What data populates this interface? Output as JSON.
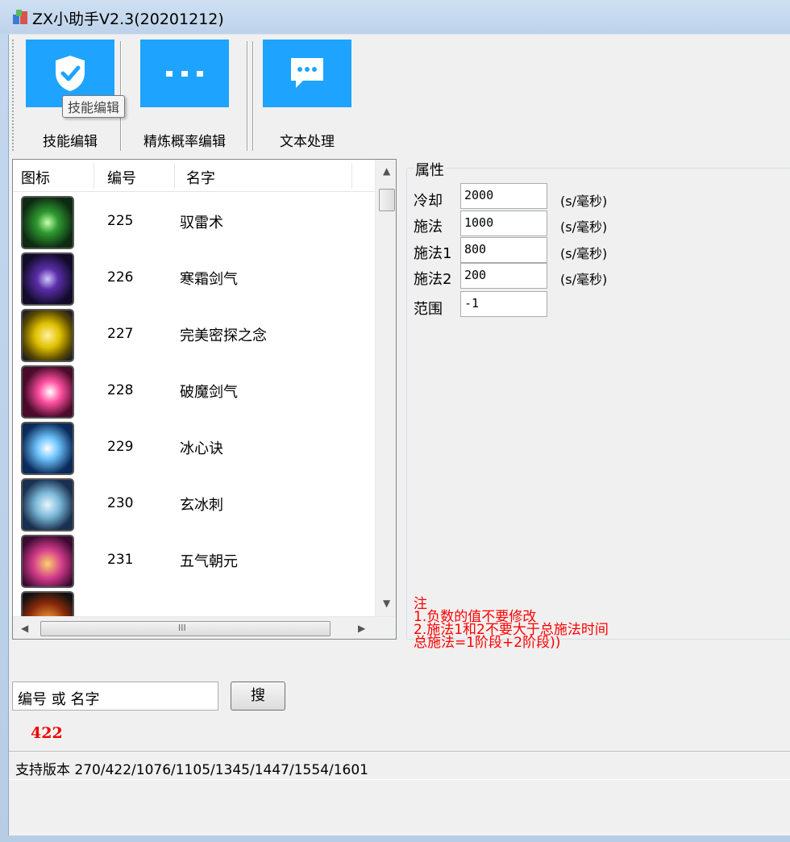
{
  "window": {
    "title": "ZX小助手V2.3(20201212)"
  },
  "toolbar": {
    "buttons": [
      {
        "label": "技能编辑",
        "icon": "shield-check-icon"
      },
      {
        "label": "精炼概率编辑",
        "icon": "dots-icon"
      },
      {
        "label": "文本处理",
        "icon": "chat-bubble-icon"
      }
    ],
    "tooltip": "技能编辑",
    "accent": "#1ea4ff"
  },
  "list": {
    "columns": [
      "图标",
      "编号",
      "名字"
    ],
    "rows": [
      {
        "id": "225",
        "name": "驭雷术",
        "icon": "lightning-skill-icon"
      },
      {
        "id": "226",
        "name": "寒霜剑气",
        "icon": "frost-sword-icon"
      },
      {
        "id": "227",
        "name": "完美密探之念",
        "icon": "golden-orb-icon"
      },
      {
        "id": "228",
        "name": "破魔剑气",
        "icon": "demon-break-icon"
      },
      {
        "id": "229",
        "name": "冰心诀",
        "icon": "ice-heart-icon"
      },
      {
        "id": "230",
        "name": "玄冰刺",
        "icon": "ice-spike-icon"
      },
      {
        "id": "231",
        "name": "五气朝元",
        "icon": "five-qi-icon"
      }
    ]
  },
  "properties": {
    "title": "属性",
    "fields": [
      {
        "label": "冷却",
        "value": "2000",
        "unit": "(s/毫秒)"
      },
      {
        "label": "施法",
        "value": "1000",
        "unit": "(s/毫秒)"
      },
      {
        "label": "施法1",
        "value": "800",
        "unit": "(s/毫秒)"
      },
      {
        "label": "施法2",
        "value": "200",
        "unit": "(s/毫秒)"
      },
      {
        "label": "范围",
        "value": "-1",
        "unit": ""
      }
    ],
    "notes": [
      "注",
      "1.负数的值不要修改",
      "2.施法1和2不要大于总施法时间",
      "总施法=1阶段+2阶段))"
    ],
    "note_color": "#ff0000"
  },
  "search": {
    "value": "编号 或 名字",
    "button_label": "搜"
  },
  "count": "422",
  "status": {
    "text": "支持版本 270/422/1076/1105/1345/1447/1554/1601"
  }
}
